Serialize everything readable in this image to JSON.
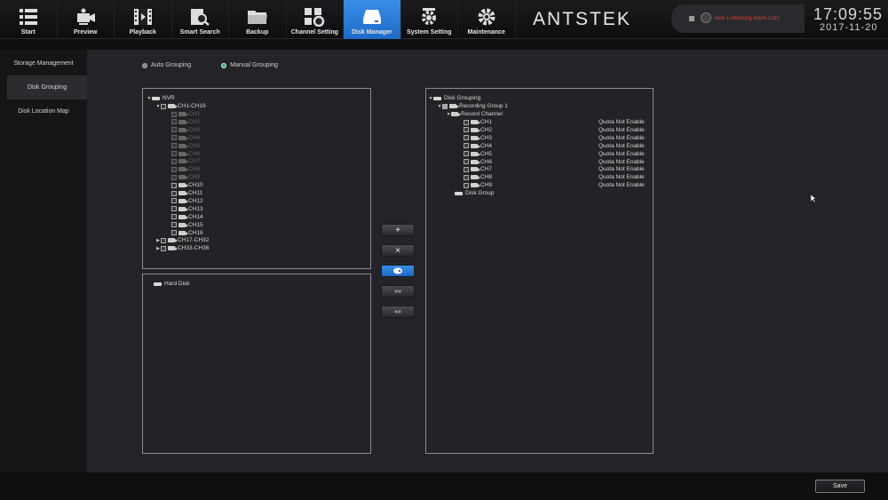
{
  "nav": [
    {
      "label": "Start",
      "icon": "list-icon"
    },
    {
      "label": "Preview",
      "icon": "preview-icon"
    },
    {
      "label": "Playback",
      "icon": "film-icon"
    },
    {
      "label": "Smart Search",
      "icon": "search-icon"
    },
    {
      "label": "Backup",
      "icon": "folder-icon"
    },
    {
      "label": "Channel Setting",
      "icon": "channel-settings-icon"
    },
    {
      "label": "Disk Manager",
      "icon": "disk-icon"
    },
    {
      "label": "System Setting",
      "icon": "system-gear-icon"
    },
    {
      "label": "Maintenance",
      "icon": "gear-icon"
    }
  ],
  "brand": "ANTSTEK",
  "alarm": {
    "text": "isk8-1-0Missing Alarm  Com"
  },
  "clock": {
    "time": "17:09:55",
    "date": "2017-11-20"
  },
  "sidebar": {
    "items": [
      "Storage Management",
      "Disk Grouping",
      "Disk Location Map"
    ]
  },
  "grouping": {
    "auto": "Auto Grouping",
    "manual": "Manual Grouping"
  },
  "left_tree": {
    "root": "NVR",
    "group1": "CH1-CH16",
    "channels": [
      "CH1",
      "CH2",
      "CH3",
      "CH4",
      "CH5",
      "CH6",
      "CH7",
      "CH8",
      "CH9",
      "CH10",
      "CH11",
      "CH12",
      "CH13",
      "CH14",
      "CH15",
      "CH16"
    ],
    "group2": "CH17-CH32",
    "group3": "CH33-CH36"
  },
  "hard_disk": {
    "label": "Hard Disk"
  },
  "right_tree": {
    "root": "Disk Grouping",
    "group": "Recording Group 1",
    "record_channel": "Record Channel",
    "channels": [
      "CH1",
      "CH2",
      "CH3",
      "CH4",
      "CH5",
      "CH6",
      "CH7",
      "CH8",
      "CH9"
    ],
    "quota": "Quota Not Enable",
    "disk_group": "Disk Group"
  },
  "buttons": {
    "add": "+",
    "remove": "×",
    "move_right": "»»",
    "move_left": "««",
    "save": "Save"
  }
}
